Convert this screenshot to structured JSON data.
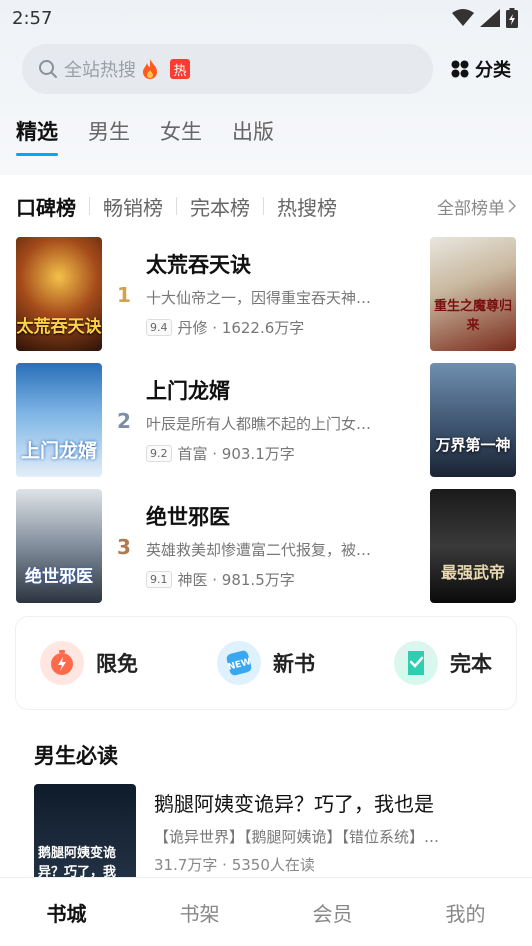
{
  "status": {
    "time": "2:57"
  },
  "search": {
    "placeholder": "全站热搜",
    "hot_badge": "热",
    "category_label": "分类"
  },
  "nav_tabs": [
    {
      "label": "精选",
      "active": true
    },
    {
      "label": "男生",
      "active": false
    },
    {
      "label": "女生",
      "active": false
    },
    {
      "label": "出版",
      "active": false
    }
  ],
  "rank_tabs": [
    {
      "label": "口碑榜",
      "active": true
    },
    {
      "label": "畅销榜",
      "active": false
    },
    {
      "label": "完本榜",
      "active": false
    },
    {
      "label": "热搜榜",
      "active": false
    }
  ],
  "rank_all_label": "全部榜单",
  "books": [
    {
      "rank": "1",
      "title": "太荒吞天诀",
      "desc": "十大仙帝之一，因得重宝吞天神…",
      "score": "9.4",
      "meta": "丹修 · 1622.6万字",
      "rank_color": "#d4a24c"
    },
    {
      "rank": "2",
      "title": "上门龙婿",
      "desc": "叶辰是所有人都瞧不起的上门女…",
      "score": "9.2",
      "meta": "首富 · 903.1万字",
      "rank_color": "#7a8ea8"
    },
    {
      "rank": "3",
      "title": "绝世邪医",
      "desc": "英雄救美却惨遭富二代报复，被…",
      "score": "9.1",
      "meta": "神医 · 981.5万字",
      "rank_color": "#b07a50"
    }
  ],
  "side_covers": [
    {
      "text": "重生之魔尊归来"
    },
    {
      "text": "万界第一神"
    },
    {
      "text": "最强武帝"
    }
  ],
  "cover_texts": [
    {
      "text": "太荒吞天诀"
    },
    {
      "text": "上门龙婿"
    },
    {
      "text": "绝世邪医"
    }
  ],
  "quick": [
    {
      "label": "限免",
      "icon": "timer-icon",
      "color": "#ff6a4d"
    },
    {
      "label": "新书",
      "icon": "new-badge-icon",
      "color": "#3aa8f0"
    },
    {
      "label": "完本",
      "icon": "book-complete-icon",
      "color": "#2ccfb0"
    }
  ],
  "must_read": {
    "section_title": "男生必读",
    "book_title": "鹅腿阿姨变诡异？巧了，我也是",
    "tags": "【诡异世界】【鹅腿阿姨诡】【错位系统】…",
    "meta": "31.7万字 · 5350人在读",
    "cover_text": "鹅腿阿姨变诡异？巧了，我"
  },
  "bottom_nav": [
    {
      "label": "书城",
      "active": true
    },
    {
      "label": "书架",
      "active": false
    },
    {
      "label": "会员",
      "active": false
    },
    {
      "label": "我的",
      "active": false
    }
  ]
}
